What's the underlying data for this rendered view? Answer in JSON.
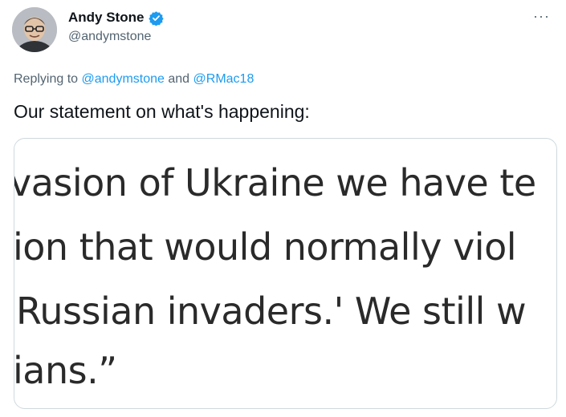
{
  "author": {
    "name": "Andy Stone",
    "handle": "@andymstone",
    "avatar_icon": "profile-photo"
  },
  "reply": {
    "prefix": "Replying to",
    "user1": "@andymstone",
    "conjunction": "and",
    "user2": "@RMac18"
  },
  "tweet": {
    "text": "Our statement on what's happening:"
  },
  "media": {
    "lines": [
      "vasion of Ukraine we have te",
      "ion that would normally viol",
      "Russian invaders.' We still w",
      "ians.”"
    ]
  },
  "menu": {
    "more_label": "···"
  },
  "colors": {
    "link": "#1d9bf0",
    "secondary_text": "#536471",
    "verified": "#1d9bf0"
  }
}
